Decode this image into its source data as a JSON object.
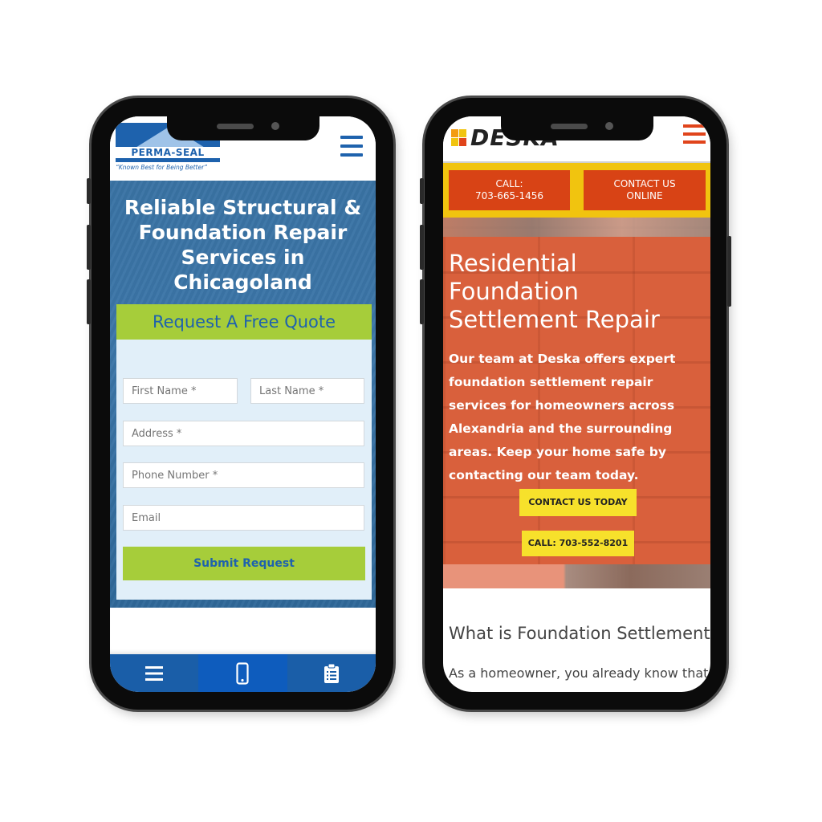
{
  "left_phone": {
    "brand": {
      "name": "PERMA-SEAL",
      "tagline": "“Known Best for Being Better”",
      "color": "#1e62ad"
    },
    "menu_icon": "hamburger-menu-icon",
    "hero_title": "Reliable Structural & Foundation Repair Services in Chicagoland",
    "form": {
      "heading": "Request A Free Quote",
      "fields": {
        "first_name": {
          "placeholder": "First Name *",
          "value": ""
        },
        "last_name": {
          "placeholder": "Last Name *",
          "value": ""
        },
        "address": {
          "placeholder": "Address *",
          "value": ""
        },
        "phone": {
          "placeholder": "Phone Number *",
          "value": ""
        },
        "email": {
          "placeholder": "Email",
          "value": ""
        }
      },
      "submit_label": "Submit Request",
      "accent_color": "#a6cd3a"
    },
    "bottom_nav": [
      {
        "icon": "menu-icon"
      },
      {
        "icon": "mobile-phone-icon"
      },
      {
        "icon": "clipboard-list-icon"
      }
    ]
  },
  "right_phone": {
    "brand": {
      "name": "DESKA",
      "accent_color": "#e0441b"
    },
    "menu_icon": "hamburger-menu-icon",
    "cta_call": {
      "line1": "CALL:",
      "line2": "703-665-1456"
    },
    "cta_contact": {
      "line1": "CONTACT US",
      "line2": "ONLINE"
    },
    "hero_title_lines": [
      "Residential",
      "Foundation",
      "Settlement Repair"
    ],
    "hero_body": "Our team at Deska offers expert foundation settlement repair services for homeowners across Alexandria and the surrounding areas. Keep your home safe by contacting our team today.",
    "contact_today_label": "CONTACT US TODAY",
    "call_label": "CALL: 703-552-8201",
    "section_heading": "What is Foundation Settlement?",
    "section_text": "As a homeowner, you already know that"
  }
}
